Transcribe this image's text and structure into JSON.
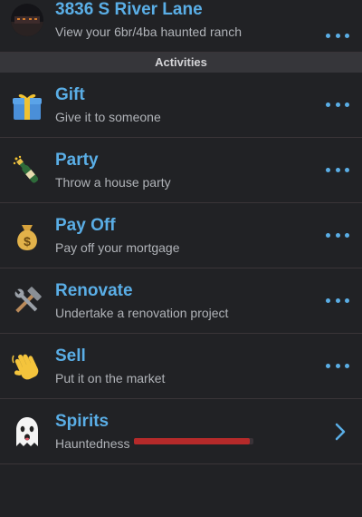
{
  "property": {
    "title": "3836 S River Lane",
    "subtitle": "View your 6br/4ba haunted ranch"
  },
  "section_header": "Activities",
  "activities": [
    {
      "title": "Gift",
      "subtitle": "Give it to someone",
      "icon": "gift-icon"
    },
    {
      "title": "Party",
      "subtitle": "Throw a house party",
      "icon": "champagne-icon"
    },
    {
      "title": "Pay Off",
      "subtitle": "Pay off your mortgage",
      "icon": "money-bag-icon"
    },
    {
      "title": "Renovate",
      "subtitle": "Undertake a renovation project",
      "icon": "hammer-wrench-icon"
    },
    {
      "title": "Sell",
      "subtitle": "Put it on the market",
      "icon": "waving-hand-icon"
    }
  ],
  "spirits": {
    "title": "Spirits",
    "label": "Hauntedness",
    "icon": "ghost-icon",
    "hauntedness_level": 0.97
  },
  "colors": {
    "accent": "#5aaee6",
    "bar": "#b52a2a",
    "background": "#212225"
  }
}
